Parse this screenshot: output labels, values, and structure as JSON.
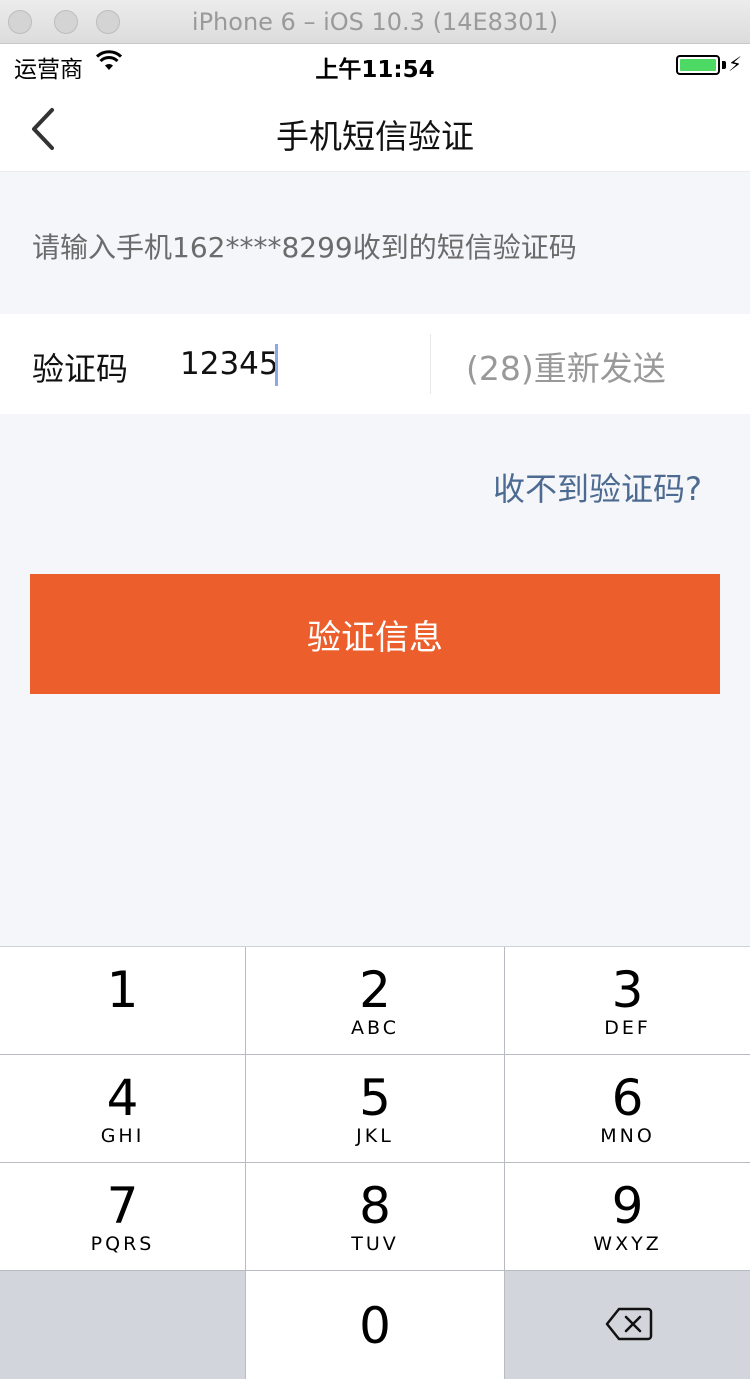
{
  "window": {
    "title": "iPhone 6 – iOS 10.3 (14E8301)"
  },
  "status_bar": {
    "carrier": "运营商",
    "time": "上午11:54",
    "battery_level": 1.0
  },
  "nav": {
    "title": "手机短信验证",
    "back_icon": "chevron-left-icon"
  },
  "hint": "请输入手机162****8299收到的短信验证码",
  "code_field": {
    "label": "验证码",
    "value": "12345",
    "resend": "(28)重新发送"
  },
  "no_code_link": "收不到验证码?",
  "verify_button": "验证信息",
  "colors": {
    "accent": "#ec5f2c",
    "link": "#4d6a91",
    "background": "#f5f6fa"
  },
  "keypad": {
    "keys": [
      {
        "digit": "1",
        "letters": ""
      },
      {
        "digit": "2",
        "letters": "ABC"
      },
      {
        "digit": "3",
        "letters": "DEF"
      },
      {
        "digit": "4",
        "letters": "GHI"
      },
      {
        "digit": "5",
        "letters": "JKL"
      },
      {
        "digit": "6",
        "letters": "MNO"
      },
      {
        "digit": "7",
        "letters": "PQRS"
      },
      {
        "digit": "8",
        "letters": "TUV"
      },
      {
        "digit": "9",
        "letters": "WXYZ"
      }
    ],
    "zero": "0",
    "delete_icon": "backspace-icon"
  }
}
